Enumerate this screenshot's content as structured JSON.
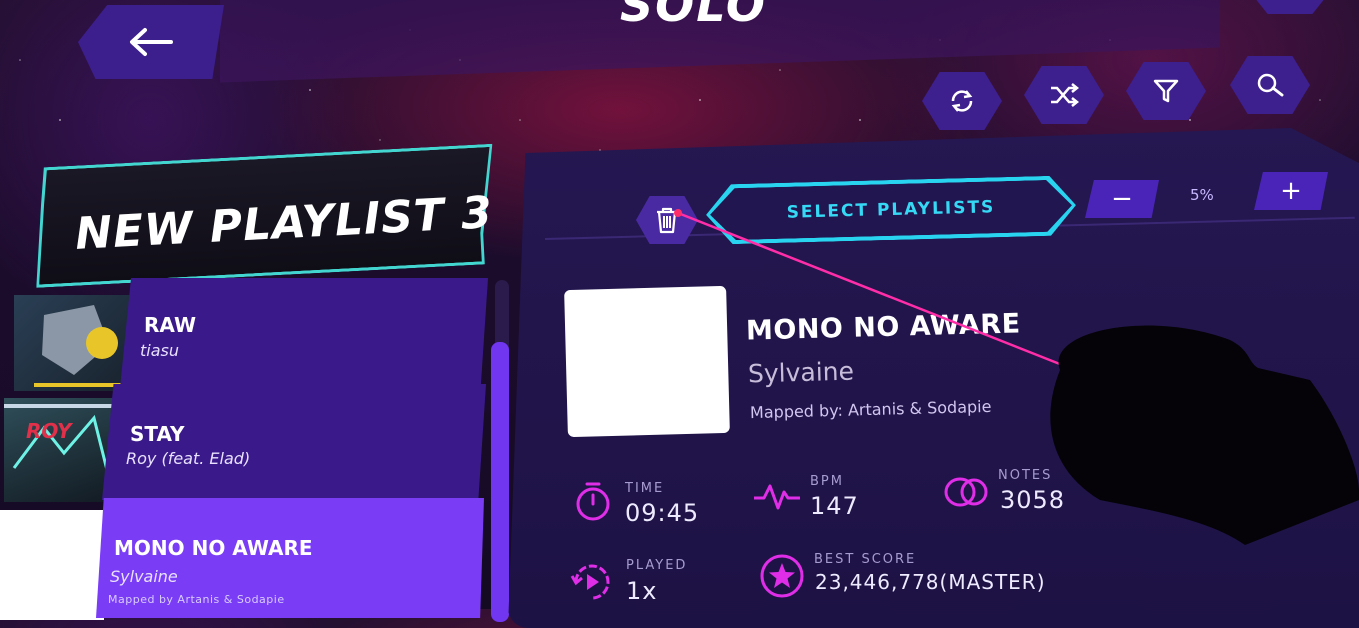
{
  "screen": {
    "title": "SOLO"
  },
  "toolbar": {
    "back_icon": "arrow-left-icon",
    "buttons": [
      {
        "name": "refresh",
        "icon": "refresh-icon"
      },
      {
        "name": "shuffle",
        "icon": "shuffle-icon"
      },
      {
        "name": "filter",
        "icon": "filter-icon"
      },
      {
        "name": "search",
        "icon": "search-icon"
      }
    ]
  },
  "playlist": {
    "title": "NEW PLAYLIST 3",
    "songs": [
      {
        "title": "RAW",
        "artist": "tiasu",
        "mapper": ""
      },
      {
        "title": "STAY",
        "artist": "Roy (feat. Elad)",
        "mapper": ""
      },
      {
        "title": "MONO NO AWARE",
        "artist": "Sylvaine",
        "mapper": "Mapped by Artanis & Sodapie",
        "selected": true
      }
    ]
  },
  "detail": {
    "select_playlists_label": "SELECT PLAYLISTS",
    "minus_label": "−",
    "plus_label": "+",
    "speed_percent": "5%",
    "song_title": "MONO NO AWARE",
    "artist": "Sylvaine",
    "mapped_by": "Mapped by: Artanis & Sodapie",
    "stats": {
      "time_label": "TIME",
      "time_value": "09:45",
      "bpm_label": "BPM",
      "bpm_value": "147",
      "notes_label": "NOTES",
      "notes_value": "3058",
      "played_label": "PLAYED",
      "played_value": "1x",
      "best_score_label": "BEST SCORE",
      "best_score_value": "23,446,778(MASTER)"
    }
  },
  "colors": {
    "accent_purple": "#3d1f8e",
    "selected_purple": "#7a3cf5",
    "cyan": "#35d9f5",
    "teal_border": "#43d6d0",
    "magenta_icon": "#e02ee8",
    "laser_pink": "#ff2ea8"
  }
}
